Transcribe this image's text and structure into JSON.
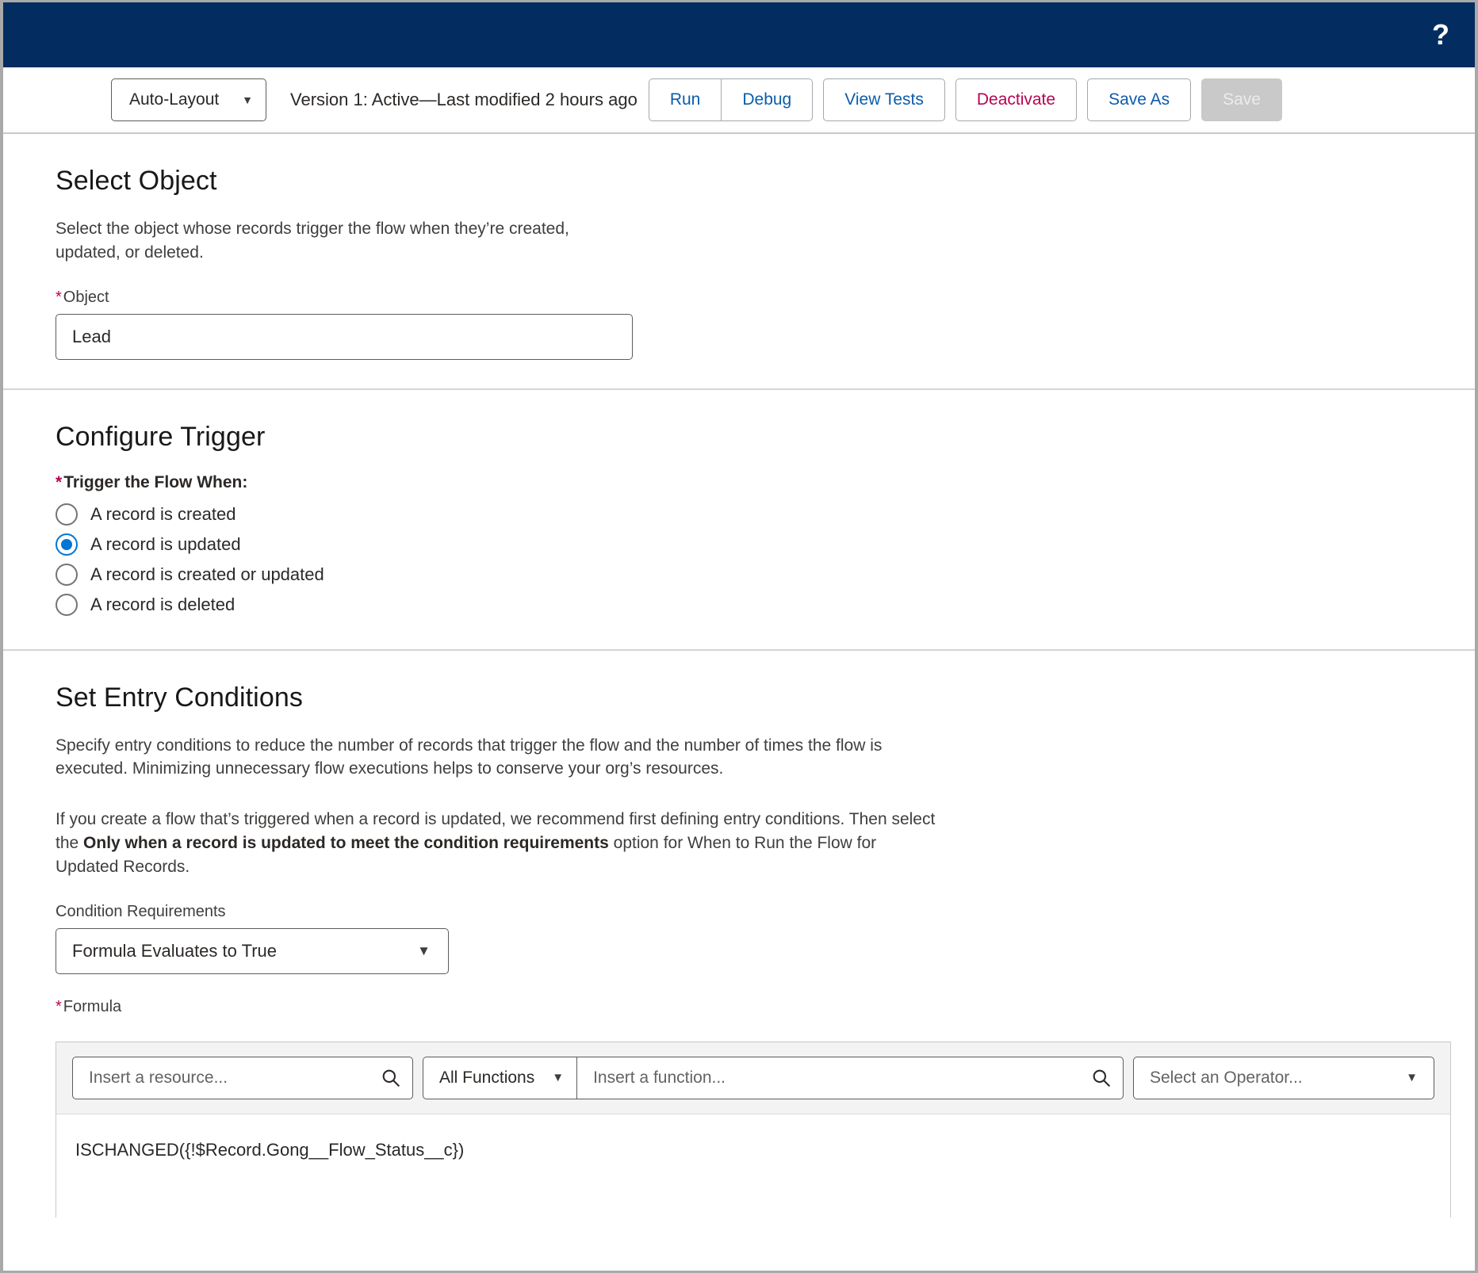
{
  "header": {
    "help_icon": "help-icon",
    "bg_color": "#032d60"
  },
  "toolbar": {
    "layout_mode": "Auto-Layout",
    "layout_caret": "▼",
    "version_status": "Version 1: Active—Last modified 2 hours ago",
    "buttons": [
      {
        "label": "Run",
        "style": "link",
        "disabled": false
      },
      {
        "label": "Debug",
        "style": "link",
        "disabled": false
      },
      {
        "label": "View Tests",
        "style": "link",
        "disabled": false
      },
      {
        "label": "Deactivate",
        "style": "danger",
        "disabled": false
      },
      {
        "label": "Save As",
        "style": "link",
        "disabled": false
      },
      {
        "label": "Save",
        "style": "disabled",
        "disabled": true
      }
    ]
  },
  "select_object": {
    "title": "Select Object",
    "description": "Select the object whose records trigger the flow when they’re created, updated, or deleted.",
    "field_label": "Object",
    "required_marker": "*",
    "object_value": "Lead"
  },
  "configure_trigger": {
    "title": "Configure Trigger",
    "legend": "Trigger the Flow When:",
    "required_marker": "*",
    "options": [
      {
        "label": "A record is created",
        "selected": false
      },
      {
        "label": "A record is updated",
        "selected": true
      },
      {
        "label": "A record is created or updated",
        "selected": false
      },
      {
        "label": "A record is deleted",
        "selected": false
      }
    ]
  },
  "entry_conditions": {
    "title": "Set Entry Conditions",
    "paragraph_1": "Specify entry conditions to reduce the number of records that trigger the flow and the number of times the flow is executed. Minimizing unnecessary flow executions helps to conserve your org’s resources.",
    "paragraph_2_pre": "If you create a flow that’s triggered when a record is updated, we recommend first defining entry conditions. Then select the ",
    "paragraph_2_bold": "Only when a record is updated to meet the condition requirements",
    "paragraph_2_post": " option for When to Run the Flow for Updated Records.",
    "condition_requirements_label": "Condition Requirements",
    "condition_requirements_value": "Formula Evaluates to True",
    "condition_caret": "▼",
    "formula_label": "Formula",
    "formula_required_marker": "*",
    "resource_placeholder": "Insert a resource...",
    "resource_search_icon": "search-icon",
    "functions_filter_value": "All Functions",
    "functions_filter_caret": "▼",
    "function_placeholder": "Insert a function...",
    "function_search_icon": "search-icon",
    "operator_placeholder": "Select an Operator...",
    "operator_caret": "▼",
    "formula_value": "ISCHANGED({!$Record.Gong__Flow_Status__c})"
  },
  "colors": {
    "brand_navy": "#032d60",
    "link_blue": "#0b5cab",
    "destructive_red": "#b60554",
    "radio_selected": "#0176d3"
  }
}
